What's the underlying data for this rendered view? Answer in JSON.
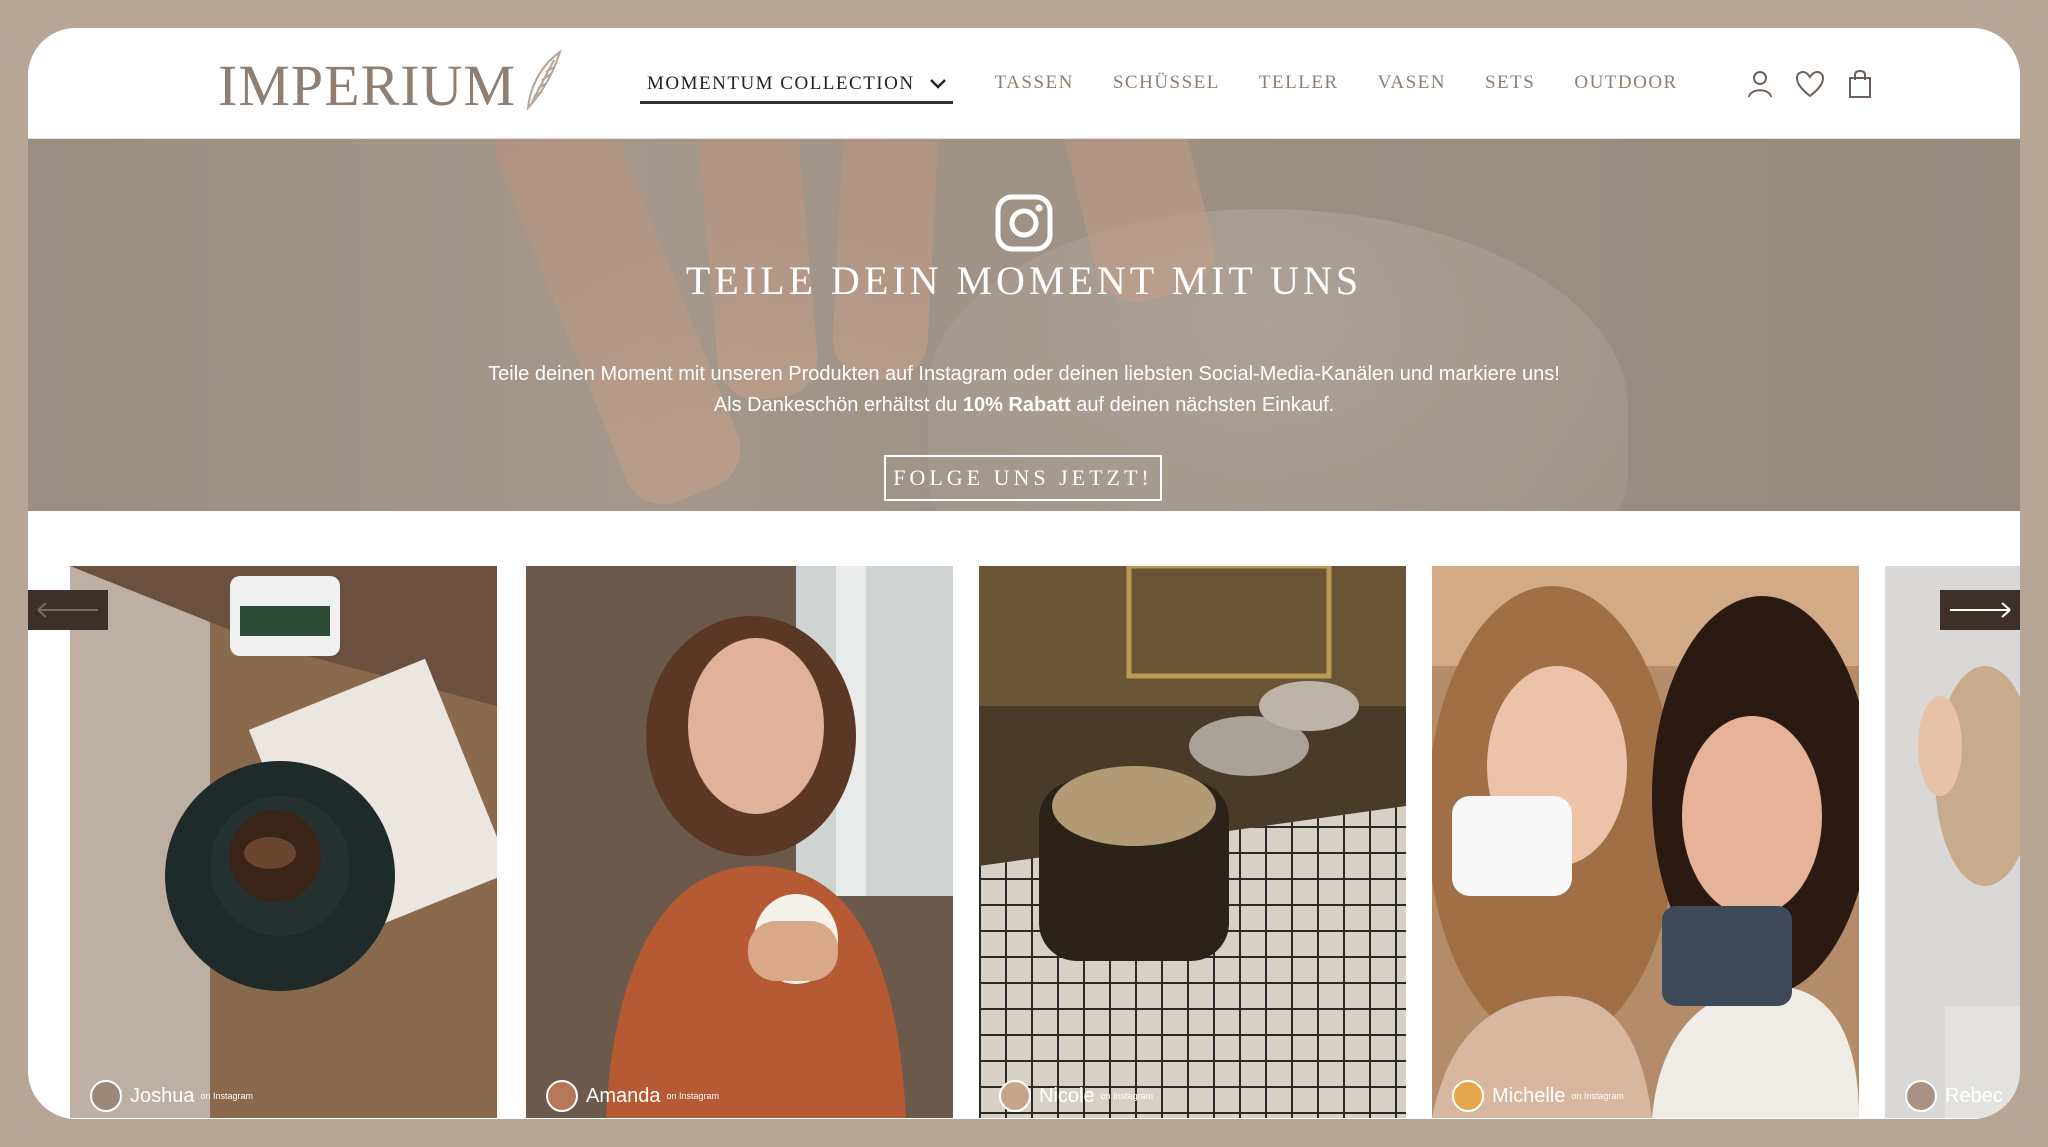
{
  "header": {
    "logo": "IMPERIUM",
    "nav": [
      {
        "label": "MOMENTUM COLLECTION"
      },
      {
        "label": "TASSEN"
      },
      {
        "label": "SCHÜSSEL"
      },
      {
        "label": "TELLER"
      },
      {
        "label": "VASEN"
      },
      {
        "label": "SETS"
      },
      {
        "label": "OUTDOOR"
      }
    ],
    "icons": [
      "user-icon",
      "heart-icon",
      "shopping-bag-icon"
    ]
  },
  "hero": {
    "title": "TEILE DEIN MOMENT MIT UNS",
    "line1": "Teile deinen Moment mit unseren Produkten auf Instagram oder deinen liebsten Social-Media-Kanälen und markiere uns!",
    "line2_prefix": "Als Dankeschön erhältst du ",
    "line2_bold": "10% Rabatt",
    "line2_suffix": " auf deinen nächsten Einkauf.",
    "button": "FOLGE UNS JETZT!"
  },
  "carousel": {
    "posts": [
      {
        "user": "Joshua",
        "source": "on Instagram"
      },
      {
        "user": "Amanda",
        "source": "on Instagram"
      },
      {
        "user": "Nicole",
        "source": "on Instagram"
      },
      {
        "user": "Michelle",
        "source": "on Instagram"
      },
      {
        "user": "Rebec",
        "source": ""
      }
    ]
  },
  "colors": {
    "frame": "#b7a596",
    "accent_text": "#8f7f72",
    "arrow_bg": "#3d3029"
  }
}
